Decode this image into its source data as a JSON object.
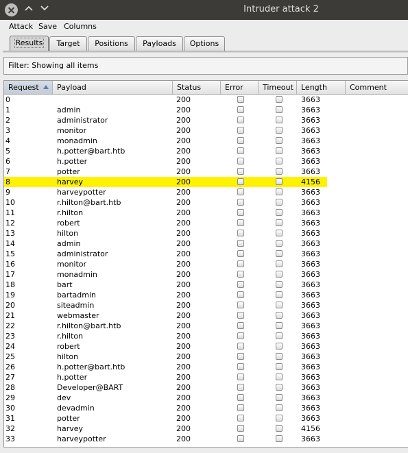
{
  "window": {
    "title": "Intruder attack 2",
    "controls": [
      "close-icon",
      "chevron-up-icon",
      "chevron-down-icon"
    ]
  },
  "menubar": {
    "items": [
      "Attack",
      "Save",
      "Columns"
    ]
  },
  "tabs": {
    "items": [
      "Results",
      "Target",
      "Positions",
      "Payloads",
      "Options"
    ],
    "active": "Results"
  },
  "filter": {
    "text": "Filter: Showing all items"
  },
  "table": {
    "columns": [
      "Request",
      "Payload",
      "Status",
      "Error",
      "Timeout",
      "Length",
      "Comment"
    ],
    "sorted_column": "Request",
    "sort_direction": "ascending",
    "highlight_color": "#fff200",
    "rows": [
      {
        "request": "0",
        "payload": "",
        "status": "200",
        "length": "3663",
        "highlighted": false
      },
      {
        "request": "1",
        "payload": "admin",
        "status": "200",
        "length": "3663",
        "highlighted": false
      },
      {
        "request": "2",
        "payload": "administrator",
        "status": "200",
        "length": "3663",
        "highlighted": false
      },
      {
        "request": "3",
        "payload": "monitor",
        "status": "200",
        "length": "3663",
        "highlighted": false
      },
      {
        "request": "4",
        "payload": "monadmin",
        "status": "200",
        "length": "3663",
        "highlighted": false
      },
      {
        "request": "5",
        "payload": "h.potter@bart.htb",
        "status": "200",
        "length": "3663",
        "highlighted": false
      },
      {
        "request": "6",
        "payload": "h.potter",
        "status": "200",
        "length": "3663",
        "highlighted": false
      },
      {
        "request": "7",
        "payload": "potter",
        "status": "200",
        "length": "3663",
        "highlighted": false
      },
      {
        "request": "8",
        "payload": "harvey",
        "status": "200",
        "length": "4156",
        "highlighted": true
      },
      {
        "request": "9",
        "payload": "harveypotter",
        "status": "200",
        "length": "3663",
        "highlighted": false
      },
      {
        "request": "10",
        "payload": "r.hilton@bart.htb",
        "status": "200",
        "length": "3663",
        "highlighted": false
      },
      {
        "request": "11",
        "payload": "r.hilton",
        "status": "200",
        "length": "3663",
        "highlighted": false
      },
      {
        "request": "12",
        "payload": "robert",
        "status": "200",
        "length": "3663",
        "highlighted": false
      },
      {
        "request": "13",
        "payload": "hilton",
        "status": "200",
        "length": "3663",
        "highlighted": false
      },
      {
        "request": "14",
        "payload": "admin",
        "status": "200",
        "length": "3663",
        "highlighted": false
      },
      {
        "request": "15",
        "payload": "administrator",
        "status": "200",
        "length": "3663",
        "highlighted": false
      },
      {
        "request": "16",
        "payload": "monitor",
        "status": "200",
        "length": "3663",
        "highlighted": false
      },
      {
        "request": "17",
        "payload": "monadmin",
        "status": "200",
        "length": "3663",
        "highlighted": false
      },
      {
        "request": "18",
        "payload": "bart",
        "status": "200",
        "length": "3663",
        "highlighted": false
      },
      {
        "request": "19",
        "payload": "bartadmin",
        "status": "200",
        "length": "3663",
        "highlighted": false
      },
      {
        "request": "20",
        "payload": "siteadmin",
        "status": "200",
        "length": "3663",
        "highlighted": false
      },
      {
        "request": "21",
        "payload": "webmaster",
        "status": "200",
        "length": "3663",
        "highlighted": false
      },
      {
        "request": "22",
        "payload": "r.hilton@bart.htb",
        "status": "200",
        "length": "3663",
        "highlighted": false
      },
      {
        "request": "23",
        "payload": "r.hilton",
        "status": "200",
        "length": "3663",
        "highlighted": false
      },
      {
        "request": "24",
        "payload": "robert",
        "status": "200",
        "length": "3663",
        "highlighted": false
      },
      {
        "request": "25",
        "payload": "hilton",
        "status": "200",
        "length": "3663",
        "highlighted": false
      },
      {
        "request": "26",
        "payload": "h.potter@bart.htb",
        "status": "200",
        "length": "3663",
        "highlighted": false
      },
      {
        "request": "27",
        "payload": "h.potter",
        "status": "200",
        "length": "3663",
        "highlighted": false
      },
      {
        "request": "28",
        "payload": "Developer@BART",
        "status": "200",
        "length": "3663",
        "highlighted": false
      },
      {
        "request": "29",
        "payload": "dev",
        "status": "200",
        "length": "3663",
        "highlighted": false
      },
      {
        "request": "30",
        "payload": "devadmin",
        "status": "200",
        "length": "3663",
        "highlighted": false
      },
      {
        "request": "31",
        "payload": "potter",
        "status": "200",
        "length": "3663",
        "highlighted": false
      },
      {
        "request": "32",
        "payload": "harvey",
        "status": "200",
        "length": "4156",
        "highlighted": false
      },
      {
        "request": "33",
        "payload": "harveypotter",
        "status": "200",
        "length": "3663",
        "highlighted": false
      }
    ]
  }
}
